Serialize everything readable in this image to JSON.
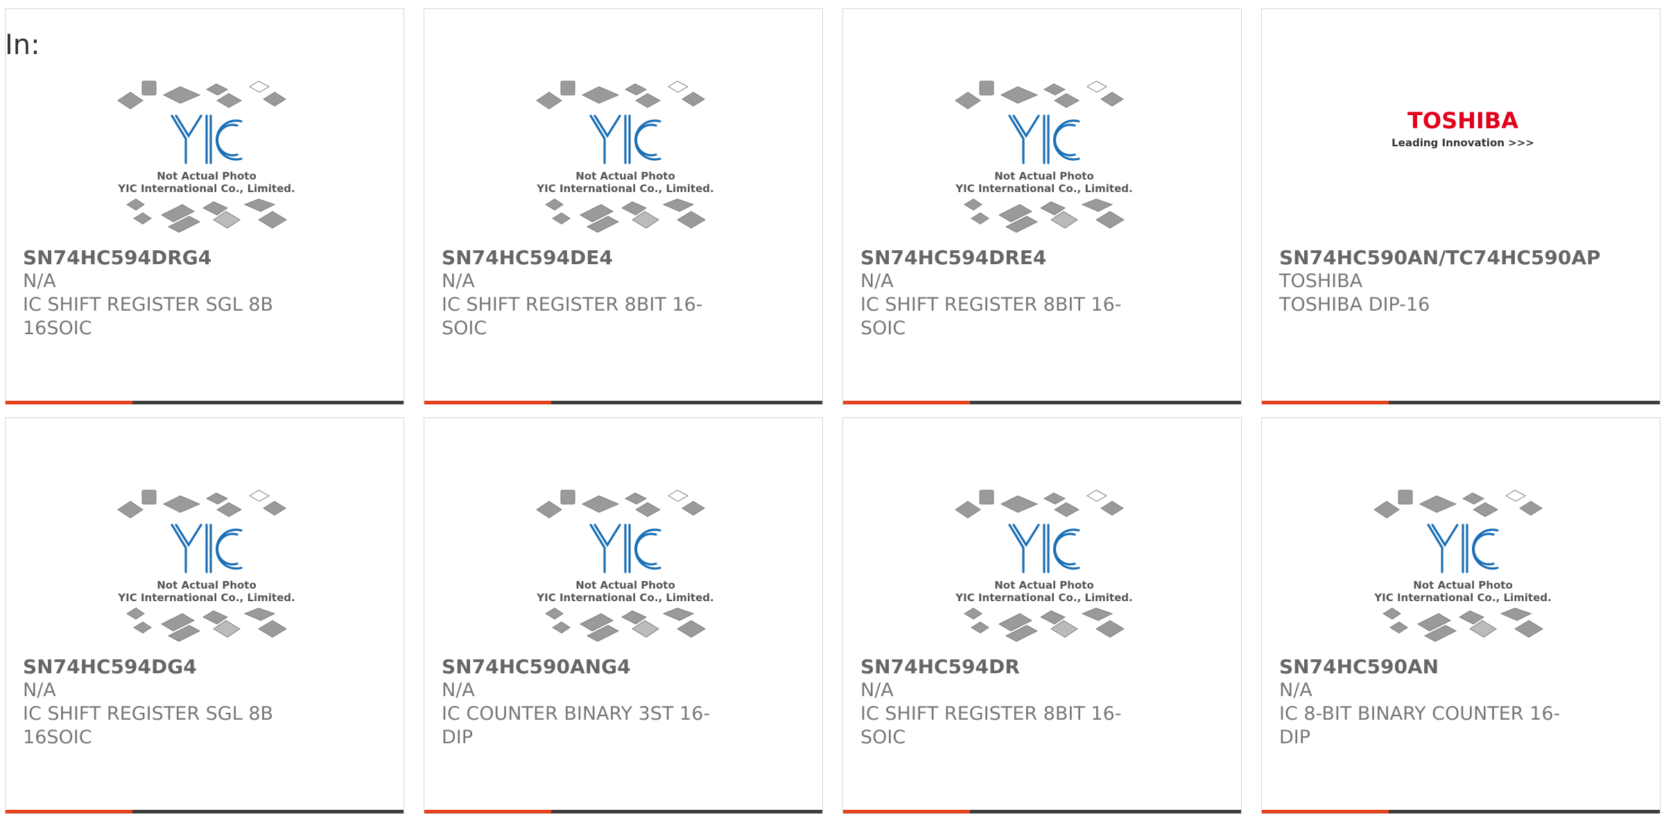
{
  "in_label": "In:",
  "placeholder": {
    "line1": "Not Actual Photo",
    "line2": "YIC International Co., Limited."
  },
  "toshiba_logo": {
    "name": "TOSHIBA",
    "tagline": "Leading Innovation >>>"
  },
  "colors": {
    "accent": "#e8401c",
    "bar": "#3e3e3e",
    "logo_blue": "#1b6fb5",
    "toshiba_red": "#e2001a"
  },
  "products": [
    {
      "part": "SN74HC594DRG4",
      "manufacturer": "N/A",
      "desc1": "IC SHIFT REGISTER SGL 8B",
      "desc2": "16SOIC",
      "image": "placeholder"
    },
    {
      "part": "SN74HC594DE4",
      "manufacturer": "N/A",
      "desc1": "IC SHIFT REGISTER 8BIT 16-",
      "desc2": "SOIC",
      "image": "placeholder"
    },
    {
      "part": "SN74HC594DRE4",
      "manufacturer": "N/A",
      "desc1": "IC SHIFT REGISTER 8BIT 16-",
      "desc2": "SOIC",
      "image": "placeholder"
    },
    {
      "part": "SN74HC590AN/TC74HC590AP",
      "manufacturer": "TOSHIBA",
      "desc1": "TOSHIBA DIP-16",
      "desc2": "",
      "image": "toshiba"
    },
    {
      "part": "SN74HC594DG4",
      "manufacturer": "N/A",
      "desc1": "IC SHIFT REGISTER SGL 8B",
      "desc2": "16SOIC",
      "image": "placeholder"
    },
    {
      "part": "SN74HC590ANG4",
      "manufacturer": "N/A",
      "desc1": "IC COUNTER BINARY 3ST 16-DIP",
      "desc2": "",
      "image": "placeholder"
    },
    {
      "part": "SN74HC594DR",
      "manufacturer": "N/A",
      "desc1": "IC SHIFT REGISTER 8BIT 16-",
      "desc2": "SOIC",
      "image": "placeholder"
    },
    {
      "part": "SN74HC590AN",
      "manufacturer": "N/A",
      "desc1": "IC 8-BIT BINARY COUNTER 16-",
      "desc2": "DIP",
      "image": "placeholder"
    }
  ]
}
